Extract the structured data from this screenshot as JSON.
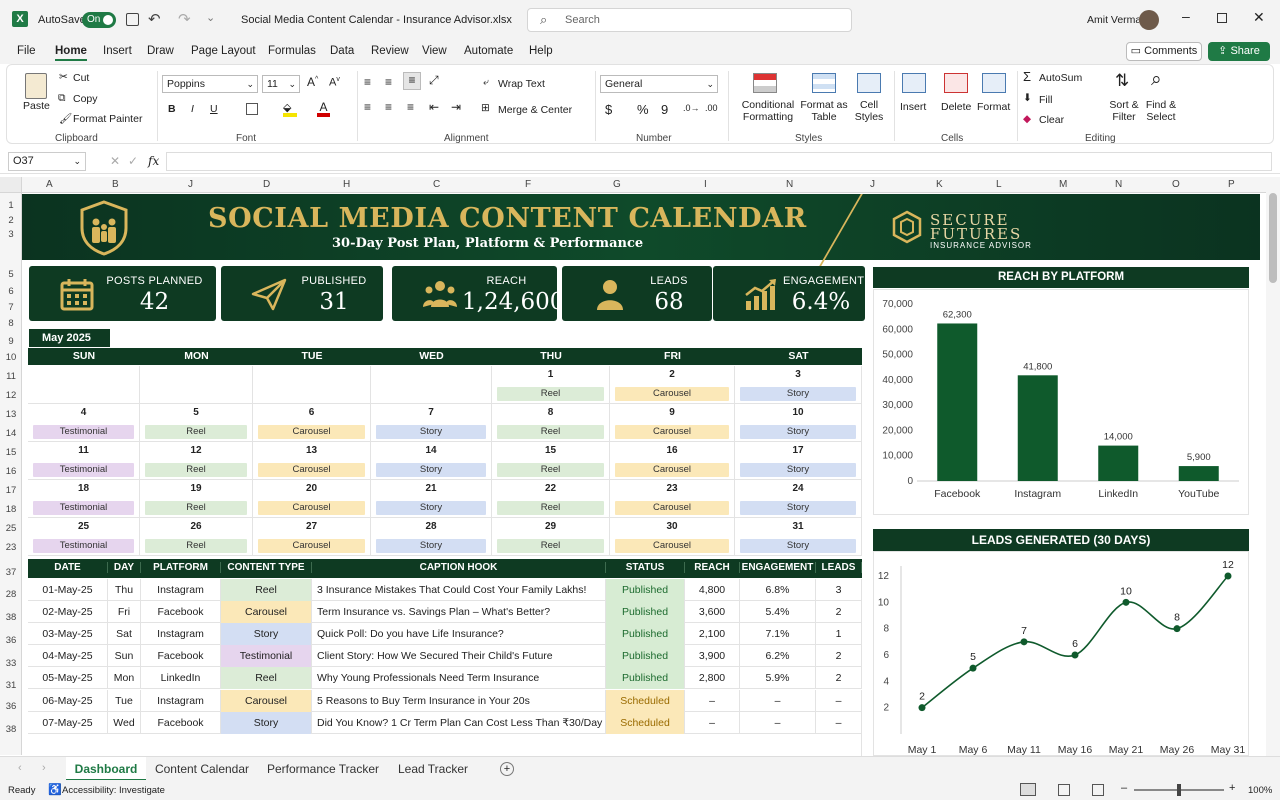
{
  "app": {
    "autosave": "AutoSave",
    "autosave_state": "On",
    "file_title": "Social Media Content Calendar - Insurance Advisor.xlsx",
    "search_placeholder": "Search",
    "user": "Amit Verma"
  },
  "menu": [
    "File",
    "Home",
    "Insert",
    "Draw",
    "Page Layout",
    "Formulas",
    "Data",
    "Review",
    "View",
    "Automate",
    "Help"
  ],
  "menu_right": {
    "comments": "Comments",
    "share": "Share"
  },
  "ribbon": {
    "paste": "Paste",
    "cut": "Cut",
    "copy": "Copy",
    "format_painter": "Format Painter",
    "clipboard": "Clipboard",
    "font_name": "Poppins",
    "font_size": "11",
    "font": "Font",
    "wrap": "Wrap Text",
    "merge": "Merge & Center",
    "alignment": "Alignment",
    "number_format": "General",
    "number": "Number",
    "cond_fmt_1": "Conditional",
    "cond_fmt_2": "Formatting",
    "fmt_table_1": "Format as",
    "fmt_table_2": "Table",
    "cell_styles_1": "Cell",
    "cell_styles_2": "Styles",
    "styles": "Styles",
    "insert": "Insert",
    "delete": "Delete",
    "format": "Format",
    "cells": "Cells",
    "autosum": "AutoSum",
    "fill": "Fill",
    "clear": "Clear",
    "sort_1": "Sort &",
    "sort_2": "Filter",
    "find_1": "Find &",
    "find_2": "Select",
    "editing": "Editing"
  },
  "formula_bar": {
    "name_box": "O37",
    "fx": "fx",
    "value": ""
  },
  "columns": [
    "A",
    "B",
    "J",
    "D",
    "H",
    "C",
    "F",
    "G",
    "I",
    "N",
    "J",
    "K",
    "L",
    "M",
    "N",
    "O",
    "P"
  ],
  "rows": [
    "1",
    "2",
    "3",
    "5",
    "6",
    "7",
    "8",
    "9",
    "10",
    "11",
    "12",
    "13",
    "14",
    "15",
    "16",
    "17",
    "18",
    "25",
    "23",
    "37",
    "28",
    "38",
    "36",
    "33",
    "31",
    "36",
    "38"
  ],
  "banner": {
    "title": "SOCIAL MEDIA CONTENT CALENDAR",
    "subtitle": "30-Day Post Plan, Platform & Performance",
    "brand_1": "SECURE",
    "brand_2": "FUTURES",
    "brand_3": "INSURANCE ADVISOR"
  },
  "kpis": [
    {
      "label": "POSTS PLANNED",
      "value": "42",
      "icon": "calendar-icon"
    },
    {
      "label": "PUBLISHED",
      "value": "31",
      "icon": "paper-plane-icon"
    },
    {
      "label": "REACH",
      "value": "1,24,600",
      "icon": "people-icon"
    },
    {
      "label": "LEADS",
      "value": "68",
      "icon": "person-icon"
    },
    {
      "label": "ENGAGEMENT",
      "value": "6.4%",
      "icon": "trend-icon"
    }
  ],
  "calendar": {
    "month": "May 2025",
    "days": [
      "SUN",
      "MON",
      "TUE",
      "WED",
      "THU",
      "FRI",
      "SAT"
    ],
    "weeks": [
      [
        {
          "d": "",
          "t": ""
        },
        {
          "d": "",
          "t": ""
        },
        {
          "d": "",
          "t": ""
        },
        {
          "d": "",
          "t": ""
        },
        {
          "d": "1",
          "t": "Reel"
        },
        {
          "d": "2",
          "t": "Carousel"
        },
        {
          "d": "3",
          "t": "Story"
        }
      ],
      [
        {
          "d": "4",
          "t": "Testimonial"
        },
        {
          "d": "5",
          "t": "Reel"
        },
        {
          "d": "6",
          "t": "Carousel"
        },
        {
          "d": "7",
          "t": "Story"
        },
        {
          "d": "8",
          "t": "Reel"
        },
        {
          "d": "9",
          "t": "Carousel"
        },
        {
          "d": "10",
          "t": "Story"
        }
      ],
      [
        {
          "d": "11",
          "t": "Testimonial"
        },
        {
          "d": "12",
          "t": "Reel"
        },
        {
          "d": "13",
          "t": "Carousel"
        },
        {
          "d": "14",
          "t": "Story"
        },
        {
          "d": "15",
          "t": "Reel"
        },
        {
          "d": "16",
          "t": "Carousel"
        },
        {
          "d": "17",
          "t": "Story"
        }
      ],
      [
        {
          "d": "18",
          "t": "Testimonial"
        },
        {
          "d": "19",
          "t": "Reel"
        },
        {
          "d": "20",
          "t": "Carousel"
        },
        {
          "d": "21",
          "t": "Story"
        },
        {
          "d": "22",
          "t": "Reel"
        },
        {
          "d": "23",
          "t": "Carousel"
        },
        {
          "d": "24",
          "t": "Story"
        }
      ],
      [
        {
          "d": "25",
          "t": "Testimonial"
        },
        {
          "d": "26",
          "t": "Reel"
        },
        {
          "d": "27",
          "t": "Carousel"
        },
        {
          "d": "28",
          "t": "Story"
        },
        {
          "d": "29",
          "t": "Reel"
        },
        {
          "d": "30",
          "t": "Carousel"
        },
        {
          "d": "31",
          "t": "Story"
        }
      ]
    ],
    "type_colors": {
      "Reel": "#dcecd7",
      "Carousel": "#fbe8b8",
      "Story": "#d3def3",
      "Testimonial": "#e6d5ee"
    }
  },
  "table": {
    "headers": [
      "DATE",
      "DAY",
      "PLATFORM",
      "CONTENT TYPE",
      "CAPTION HOOK",
      "STATUS",
      "REACH",
      "ENGAGEMENT",
      "LEADS"
    ],
    "rows": [
      [
        "01-May-25",
        "Thu",
        "Instagram",
        "Reel",
        "3 Insurance Mistakes That Could Cost Your Family Lakhs!",
        "Published",
        "4,800",
        "6.8%",
        "3"
      ],
      [
        "02-May-25",
        "Fri",
        "Facebook",
        "Carousel",
        "Term Insurance vs. Savings Plan – What's Better?",
        "Published",
        "3,600",
        "5.4%",
        "2"
      ],
      [
        "03-May-25",
        "Sat",
        "Instagram",
        "Story",
        "Quick Poll: Do you have Life Insurance?",
        "Published",
        "2,100",
        "7.1%",
        "1"
      ],
      [
        "04-May-25",
        "Sun",
        "Facebook",
        "Testimonial",
        "Client Story: How We Secured Their Child's Future",
        "Published",
        "3,900",
        "6.2%",
        "2"
      ],
      [
        "05-May-25",
        "Mon",
        "LinkedIn",
        "Reel",
        "Why Young Professionals Need Term Insurance",
        "Published",
        "2,800",
        "5.9%",
        "2"
      ],
      [
        "06-May-25",
        "Tue",
        "Instagram",
        "Carousel",
        "5 Reasons to Buy Term Insurance in Your 20s",
        "Scheduled",
        "–",
        "–",
        "–"
      ],
      [
        "07-May-25",
        "Wed",
        "Facebook",
        "Story",
        "Did You Know? 1 Cr Term Plan Can Cost Less Than ₹30/Day",
        "Scheduled",
        "–",
        "–",
        "–"
      ]
    ],
    "status_colors": {
      "Published": "#d7ecd3",
      "Scheduled": "#fbe8b8"
    }
  },
  "chart_data": [
    {
      "type": "bar",
      "title": "REACH BY PLATFORM",
      "categories": [
        "Facebook",
        "Instagram",
        "LinkedIn",
        "YouTube"
      ],
      "values": [
        62300,
        41800,
        14000,
        5900
      ],
      "value_labels": [
        "62,300",
        "41,800",
        "14,000",
        "5,900"
      ],
      "ylim": [
        0,
        70000
      ],
      "yticks": [
        "0",
        "10,000",
        "20,000",
        "30,000",
        "40,000",
        "50,000",
        "60,000",
        "70,000"
      ],
      "color": "#0f5a2c"
    },
    {
      "type": "line",
      "title": "LEADS GENERATED (30 DAYS)",
      "categories": [
        "May 1",
        "May 6",
        "May 11",
        "May 16",
        "May 21",
        "May 26",
        "May 31"
      ],
      "values": [
        2,
        5,
        7,
        6,
        10,
        8,
        12
      ],
      "ylim": [
        0,
        12
      ],
      "yticks": [
        "2",
        "4",
        "6",
        "8",
        "10",
        "12"
      ],
      "color": "#0f5a2c"
    }
  ],
  "sheets": [
    "Dashboard",
    "Content Calendar",
    "Performance Tracker",
    "Lead Tracker"
  ],
  "status": {
    "ready": "Ready",
    "accessibility": "Accessibility: Investigate",
    "zoom": "100%"
  }
}
